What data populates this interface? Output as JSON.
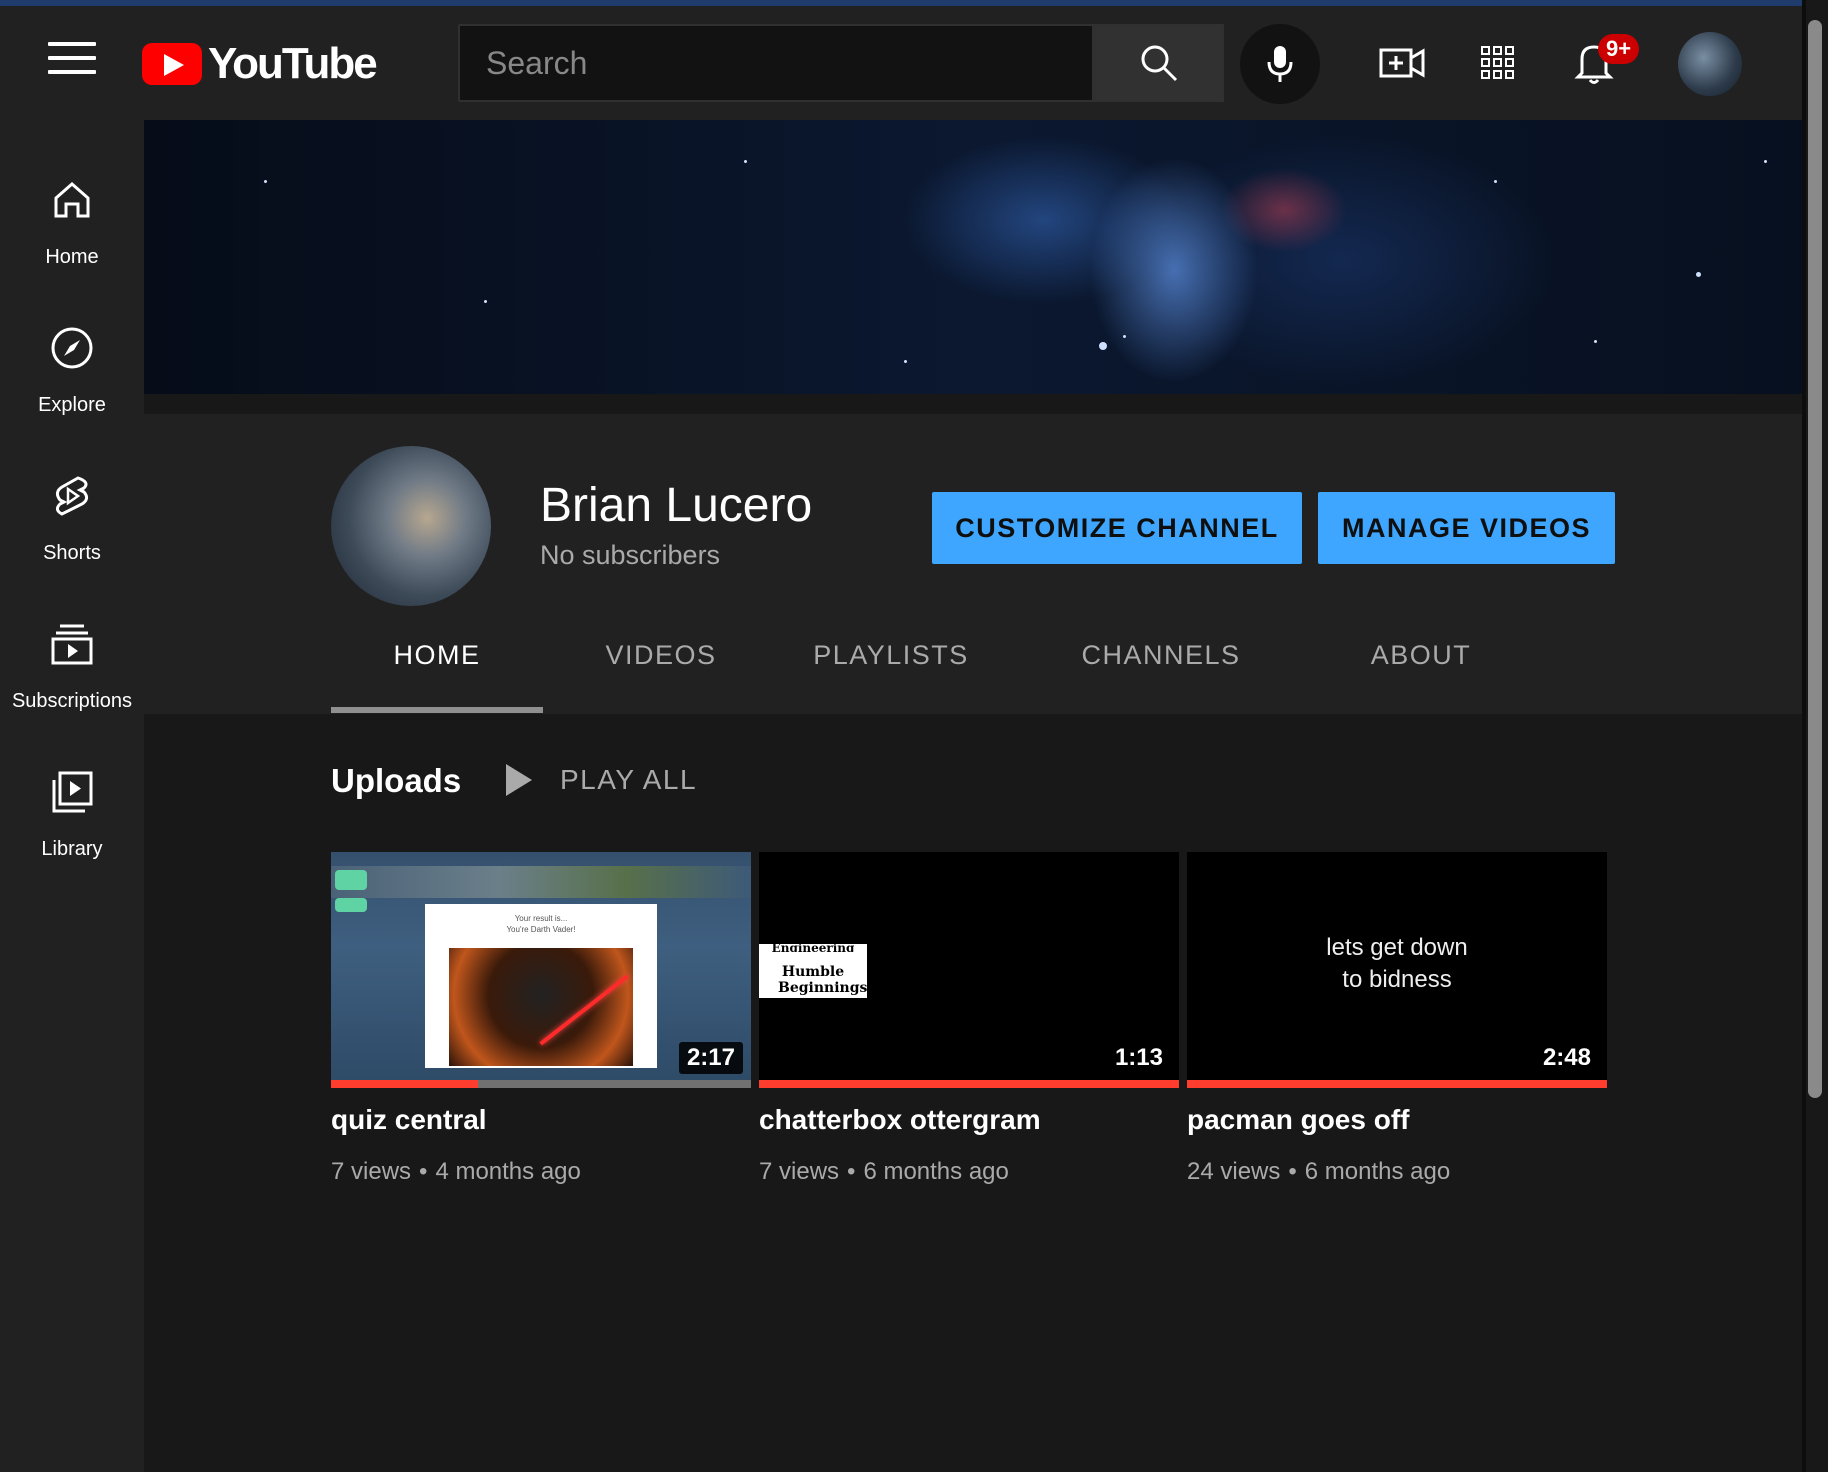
{
  "header": {
    "logo_text": "YouTube",
    "search_placeholder": "Search",
    "notification_badge": "9+"
  },
  "sidebar": {
    "items": [
      {
        "label": "Home",
        "icon": "home-icon"
      },
      {
        "label": "Explore",
        "icon": "compass-icon"
      },
      {
        "label": "Shorts",
        "icon": "shorts-icon"
      },
      {
        "label": "Subscriptions",
        "icon": "subscriptions-icon"
      },
      {
        "label": "Library",
        "icon": "library-icon"
      }
    ]
  },
  "channel": {
    "name": "Brian Lucero",
    "subscribers": "No subscribers",
    "customize_label": "CUSTOMIZE CHANNEL",
    "manage_label": "MANAGE VIDEOS"
  },
  "tabs": [
    {
      "label": "HOME",
      "active": true
    },
    {
      "label": "VIDEOS",
      "active": false
    },
    {
      "label": "PLAYLISTS",
      "active": false
    },
    {
      "label": "CHANNELS",
      "active": false
    },
    {
      "label": "ABOUT",
      "active": false
    }
  ],
  "uploads": {
    "title": "Uploads",
    "play_all": "PLAY ALL",
    "videos": [
      {
        "title": "quiz central",
        "views": "7 views",
        "age": "4 months ago",
        "duration": "2:17",
        "progress": 0.35,
        "thumb_caption_1": "Your result is...",
        "thumb_caption_2": "You're Darth Vader!"
      },
      {
        "title": "chatterbox ottergram",
        "views": "7 views",
        "age": "6 months ago",
        "duration": "1:13",
        "progress": 1.0,
        "thumb_caption_1": "Engineering",
        "thumb_caption_2": "Humble Beginnings"
      },
      {
        "title": "pacman goes off",
        "views": "24 views",
        "age": "6 months ago",
        "duration": "2:48",
        "progress": 1.0,
        "thumb_caption_1": "lets get down",
        "thumb_caption_2": "to bidness"
      }
    ]
  },
  "colors": {
    "accent_blue": "#3ea6ff",
    "progress_red": "#ff3d2e",
    "brand_red": "#ff0000"
  }
}
